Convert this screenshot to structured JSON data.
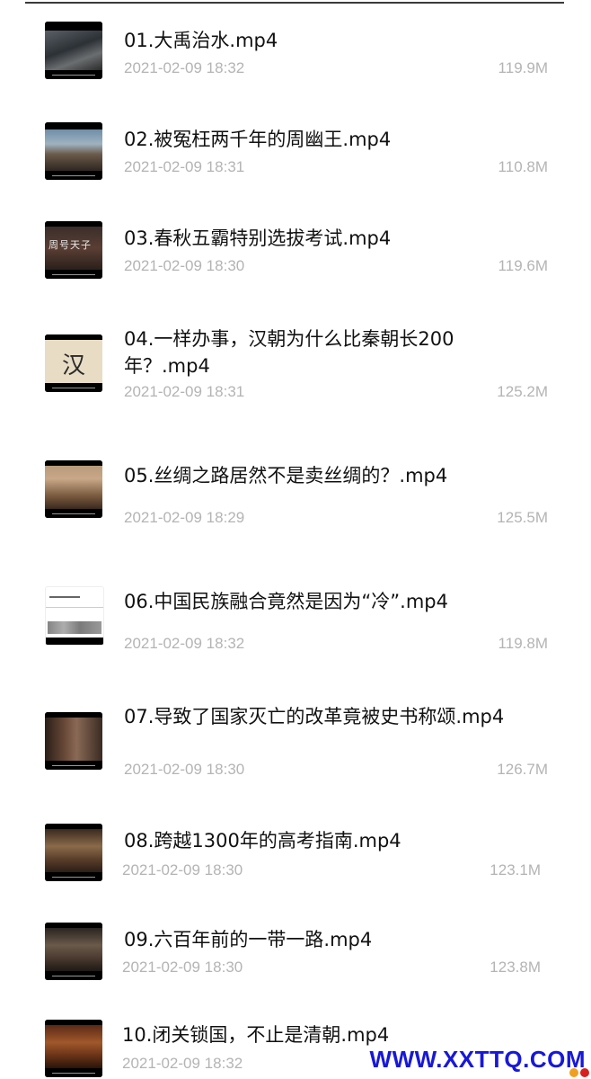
{
  "files": [
    {
      "name": "01.大禹治水.mp4",
      "date": "2021-02-09 18:32",
      "size": "119.9M",
      "thumb_icon": "video-thumbnail-icon"
    },
    {
      "name": "02.被冤枉两千年的周幽王.mp4",
      "date": "2021-02-09 18:31",
      "size": "110.8M",
      "thumb_icon": "video-thumbnail-icon"
    },
    {
      "name": "03.春秋五霸特别选拔考试.mp4",
      "date": "2021-02-09 18:30",
      "size": "119.6M",
      "thumb_icon": "video-thumbnail-icon"
    },
    {
      "name": "04.一样办事，汉朝为什么比秦朝长200年？.mp4",
      "date": "2021-02-09 18:31",
      "size": "125.2M",
      "thumb_icon": "video-thumbnail-icon"
    },
    {
      "name": "05.丝绸之路居然不是卖丝绸的？.mp4",
      "date": "2021-02-09 18:29",
      "size": "125.5M",
      "thumb_icon": "video-thumbnail-icon"
    },
    {
      "name": "06.中国民族融合竟然是因为“冷”.mp4",
      "date": "2021-02-09 18:32",
      "size": "119.8M",
      "thumb_icon": "video-thumbnail-icon"
    },
    {
      "name": "07.导致了国家灭亡的改革竟被史书称颂.mp4",
      "date": "2021-02-09 18:30",
      "size": "126.7M",
      "thumb_icon": "video-thumbnail-icon"
    },
    {
      "name": "08.跨越1300年的高考指南.mp4",
      "date": "2021-02-09 18:30",
      "size": "123.1M",
      "thumb_icon": "video-thumbnail-icon"
    },
    {
      "name": "09.六百年前的一带一路.mp4",
      "date": "2021-02-09 18:30",
      "size": "123.8M",
      "thumb_icon": "video-thumbnail-icon"
    },
    {
      "name": "10.闭关锁国，不止是清朝.mp4",
      "date": "2021-02-09 18:32",
      "size": "",
      "thumb_icon": "video-thumbnail-icon"
    }
  ],
  "thumb_text": {
    "t3": "周号天子",
    "t4": "汉"
  },
  "watermark": {
    "text": "WWW.XXTTQ.COM",
    "color": "#1818d8"
  },
  "colors": {
    "name_text": "#111111",
    "meta_text": "#b4b4b4",
    "watermark": "#1818d8"
  }
}
